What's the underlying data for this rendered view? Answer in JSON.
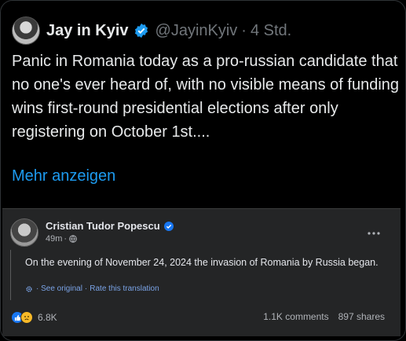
{
  "tweet": {
    "author_name": "Jay in Kyiv",
    "handle": "@JayinKyiv",
    "separator": "·",
    "time": "4 Std.",
    "text": "Panic in Romania today as a pro-russian candidate that no one's ever heard of, with no visible means of funding wins first-round presidential elections after only registering on October 1st....",
    "show_more": "Mehr anzeigen",
    "colors": {
      "accent": "#1d9bf0",
      "background": "#000000"
    }
  },
  "facebook_post": {
    "author_name": "Cristian Tudor Popescu",
    "time": "49m",
    "meta_separator": "·",
    "menu_icon": "more-dots-icon",
    "text": "On the evening of November 24, 2024 the invasion of Romania by Russia began.",
    "see_original": "· See original",
    "translation_separator": "·",
    "rate_translation": "Rate this translation",
    "reactions_count": "6.8K",
    "comments": "1.1K comments",
    "shares": "897 shares",
    "colors": {
      "background": "#242526",
      "link": "#7aa3e6"
    }
  }
}
